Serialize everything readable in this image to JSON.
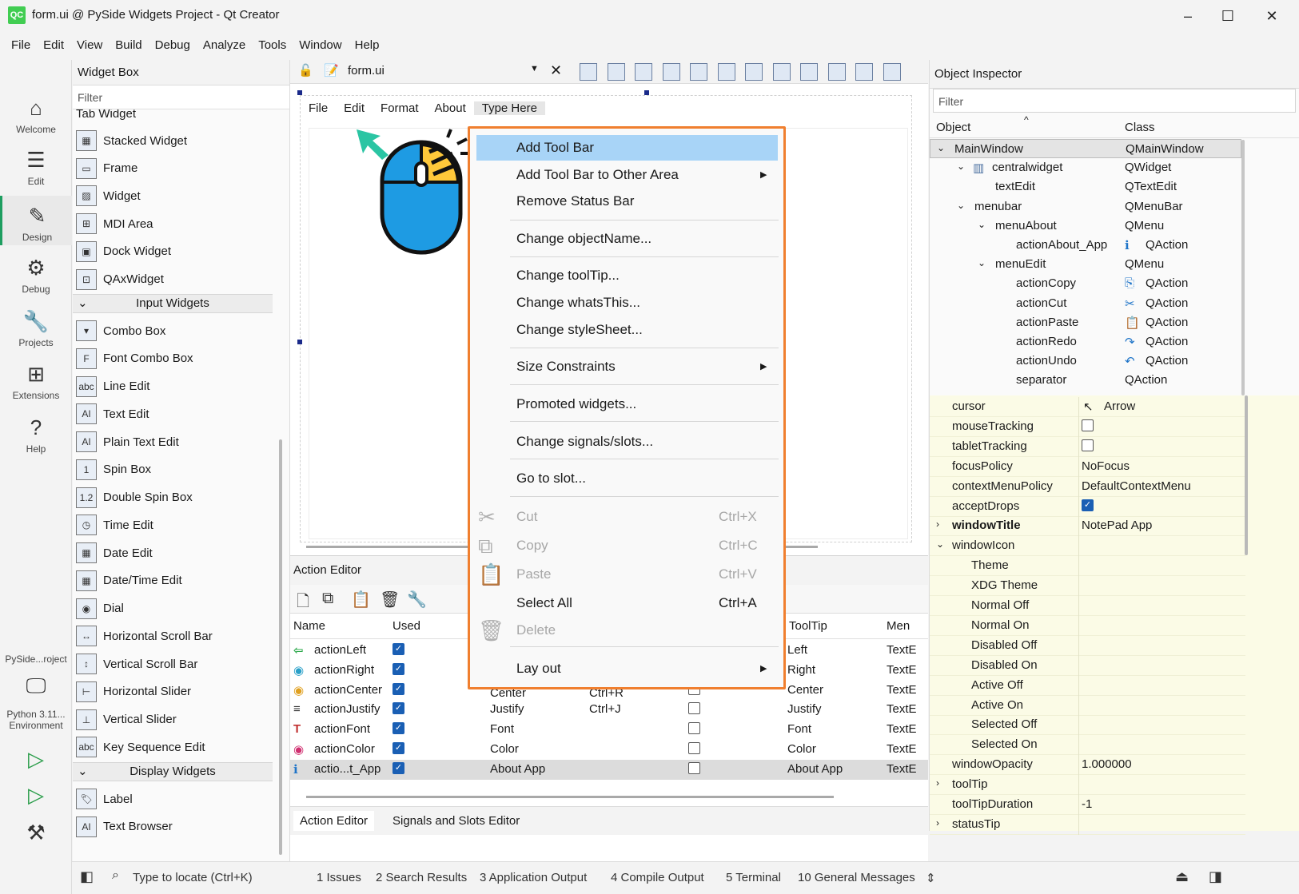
{
  "window": {
    "title": "form.ui @ PySide Widgets Project - Qt Creator",
    "logo": "QC",
    "controls": {
      "minimize": "–",
      "maximize": "☐",
      "close": "✕"
    }
  },
  "menubar": [
    "File",
    "Edit",
    "View",
    "Build",
    "Debug",
    "Analyze",
    "Tools",
    "Window",
    "Help"
  ],
  "modes": [
    {
      "label": "Welcome",
      "icon": "home-icon"
    },
    {
      "label": "Edit",
      "icon": "edit-icon"
    },
    {
      "label": "Design",
      "icon": "pen-icon"
    },
    {
      "label": "Debug",
      "icon": "bug-icon"
    },
    {
      "label": "Projects",
      "icon": "wrench-icon"
    },
    {
      "label": "Extensions",
      "icon": "grid-icon"
    },
    {
      "label": "Help",
      "icon": "help-icon"
    }
  ],
  "kit": {
    "project": "PySide...roject",
    "env": "Python 3.11...\nEnvironment"
  },
  "widget_box": {
    "title": "Widget Box",
    "filter_placeholder": "Filter",
    "partial_item": "Tab Widget",
    "items_a": [
      "Stacked Widget",
      "Frame",
      "Widget",
      "MDI Area",
      "Dock Widget",
      "QAxWidget"
    ],
    "cat_input": "Input Widgets",
    "items_b": [
      "Combo Box",
      "Font Combo Box",
      "Line Edit",
      "Text Edit",
      "Plain Text Edit",
      "Spin Box",
      "Double Spin Box",
      "Time Edit",
      "Date Edit",
      "Date/Time Edit",
      "Dial",
      "Horizontal Scroll Bar",
      "Vertical Scroll Bar",
      "Horizontal Slider",
      "Vertical Slider",
      "Key Sequence Edit"
    ],
    "cat_display": "Display Widgets",
    "items_c": [
      "Label",
      "Text Browser"
    ]
  },
  "editor": {
    "file": "form.ui",
    "form_menu": [
      "File",
      "Edit",
      "Format",
      "About",
      "Type Here"
    ]
  },
  "context_menu": {
    "items": [
      {
        "label": "Add Tool Bar",
        "highlight": true
      },
      {
        "label": "Add Tool Bar to Other Area",
        "submenu": true
      },
      {
        "label": "Remove Status Bar"
      },
      {
        "label": "Change objectName..."
      },
      {
        "label": "Change toolTip..."
      },
      {
        "label": "Change whatsThis..."
      },
      {
        "label": "Change styleSheet..."
      },
      {
        "label": "Size Constraints",
        "submenu": true
      },
      {
        "label": "Promoted widgets..."
      },
      {
        "label": "Change signals/slots..."
      },
      {
        "label": "Go to slot..."
      },
      {
        "label": "Cut",
        "shortcut": "Ctrl+X",
        "disabled": true
      },
      {
        "label": "Copy",
        "shortcut": "Ctrl+C",
        "disabled": true
      },
      {
        "label": "Paste",
        "shortcut": "Ctrl+V",
        "disabled": true
      },
      {
        "label": "Select All",
        "shortcut": "Ctrl+A"
      },
      {
        "label": "Delete",
        "disabled": true
      },
      {
        "label": "Lay out",
        "submenu": true
      }
    ]
  },
  "action_editor": {
    "title": "Action Editor",
    "columns": [
      "Name",
      "Used",
      "ToolTip",
      "Men"
    ],
    "partial_row": {
      "text": "Center",
      "shortcut": "Ctrl+R"
    },
    "rows": [
      {
        "name": "actionLeft",
        "used": true,
        "text": "",
        "shortcut": "",
        "checkable": null,
        "tooltip": "Left",
        "menu": "TextE"
      },
      {
        "name": "actionRight",
        "used": true,
        "text": "",
        "shortcut": "",
        "checkable": null,
        "tooltip": "Right",
        "menu": "TextE"
      },
      {
        "name": "actionCenter",
        "used": true,
        "text": "",
        "shortcut": "",
        "checkable": false,
        "tooltip": "Center",
        "menu": "TextE"
      },
      {
        "name": "actionJustify",
        "used": true,
        "text": "Justify",
        "shortcut": "Ctrl+J",
        "checkable": false,
        "tooltip": "Justify",
        "menu": "TextE"
      },
      {
        "name": "actionFont",
        "used": true,
        "text": "Font",
        "shortcut": "",
        "checkable": false,
        "tooltip": "Font",
        "menu": "TextE"
      },
      {
        "name": "actionColor",
        "used": true,
        "text": "Color",
        "shortcut": "",
        "checkable": false,
        "tooltip": "Color",
        "menu": "TextE"
      },
      {
        "name": "actio...t_App",
        "used": true,
        "text": "About App",
        "shortcut": "",
        "checkable": false,
        "tooltip": "About App",
        "menu": "TextE"
      }
    ],
    "tabs": [
      "Action Editor",
      "Signals and Slots Editor"
    ]
  },
  "object_inspector": {
    "title": "Object Inspector",
    "filter_placeholder": "Filter",
    "columns": [
      "Object",
      "Class"
    ],
    "rows": [
      {
        "obj": "MainWindow",
        "cls": "QMainWindow",
        "depth": 0,
        "exp": "v"
      },
      {
        "obj": "centralwidget",
        "cls": "QWidget",
        "depth": 1,
        "exp": "v"
      },
      {
        "obj": "textEdit",
        "cls": "QTextEdit",
        "depth": 2,
        "exp": ""
      },
      {
        "obj": "menubar",
        "cls": "QMenuBar",
        "depth": 1,
        "exp": "v"
      },
      {
        "obj": "menuAbout",
        "cls": "QMenu",
        "depth": 2,
        "exp": "v"
      },
      {
        "obj": "actionAbout_App",
        "cls": "QAction",
        "depth": 3,
        "exp": ""
      },
      {
        "obj": "menuEdit",
        "cls": "QMenu",
        "depth": 2,
        "exp": "v"
      },
      {
        "obj": "actionCopy",
        "cls": "QAction",
        "depth": 3,
        "exp": ""
      },
      {
        "obj": "actionCut",
        "cls": "QAction",
        "depth": 3,
        "exp": ""
      },
      {
        "obj": "actionPaste",
        "cls": "QAction",
        "depth": 3,
        "exp": ""
      },
      {
        "obj": "actionRedo",
        "cls": "QAction",
        "depth": 3,
        "exp": ""
      },
      {
        "obj": "actionUndo",
        "cls": "QAction",
        "depth": 3,
        "exp": ""
      },
      {
        "obj": "separator",
        "cls": "QAction",
        "depth": 3,
        "exp": ""
      }
    ]
  },
  "properties": [
    {
      "name": "cursor",
      "value": "Arrow",
      "indent": 0,
      "exp": ""
    },
    {
      "name": "mouseTracking",
      "value": "",
      "check": false,
      "indent": 0,
      "exp": ""
    },
    {
      "name": "tabletTracking",
      "value": "",
      "check": false,
      "indent": 0,
      "exp": ""
    },
    {
      "name": "focusPolicy",
      "value": "NoFocus",
      "indent": 0,
      "exp": ""
    },
    {
      "name": "contextMenuPolicy",
      "value": "DefaultContextMenu",
      "indent": 0,
      "exp": ""
    },
    {
      "name": "acceptDrops",
      "value": "",
      "check": true,
      "indent": 0,
      "exp": ""
    },
    {
      "name": "windowTitle",
      "value": "NotePad App",
      "indent": 0,
      "exp": ">",
      "bold": true
    },
    {
      "name": "windowIcon",
      "value": "",
      "indent": 0,
      "exp": "v"
    },
    {
      "name": "Theme",
      "value": "",
      "indent": 1,
      "exp": ""
    },
    {
      "name": "XDG Theme",
      "value": "",
      "indent": 1,
      "exp": ""
    },
    {
      "name": "Normal Off",
      "value": "",
      "indent": 1,
      "exp": ""
    },
    {
      "name": "Normal On",
      "value": "",
      "indent": 1,
      "exp": ""
    },
    {
      "name": "Disabled Off",
      "value": "",
      "indent": 1,
      "exp": ""
    },
    {
      "name": "Disabled On",
      "value": "",
      "indent": 1,
      "exp": ""
    },
    {
      "name": "Active Off",
      "value": "",
      "indent": 1,
      "exp": ""
    },
    {
      "name": "Active On",
      "value": "",
      "indent": 1,
      "exp": ""
    },
    {
      "name": "Selected Off",
      "value": "",
      "indent": 1,
      "exp": ""
    },
    {
      "name": "Selected On",
      "value": "",
      "indent": 1,
      "exp": ""
    },
    {
      "name": "windowOpacity",
      "value": "1.000000",
      "indent": 0,
      "exp": ""
    },
    {
      "name": "toolTip",
      "value": "",
      "indent": 0,
      "exp": ">"
    },
    {
      "name": "toolTipDuration",
      "value": "-1",
      "indent": 0,
      "exp": ""
    },
    {
      "name": "statusTip",
      "value": "",
      "indent": 0,
      "exp": ">"
    }
  ],
  "statusbar": {
    "locate_placeholder": "Type to locate (Ctrl+K)",
    "panes": [
      "1  Issues",
      "2  Search Results",
      "3  Application Output",
      "4  Compile Output",
      "5  Terminal",
      "10  General Messages"
    ]
  }
}
